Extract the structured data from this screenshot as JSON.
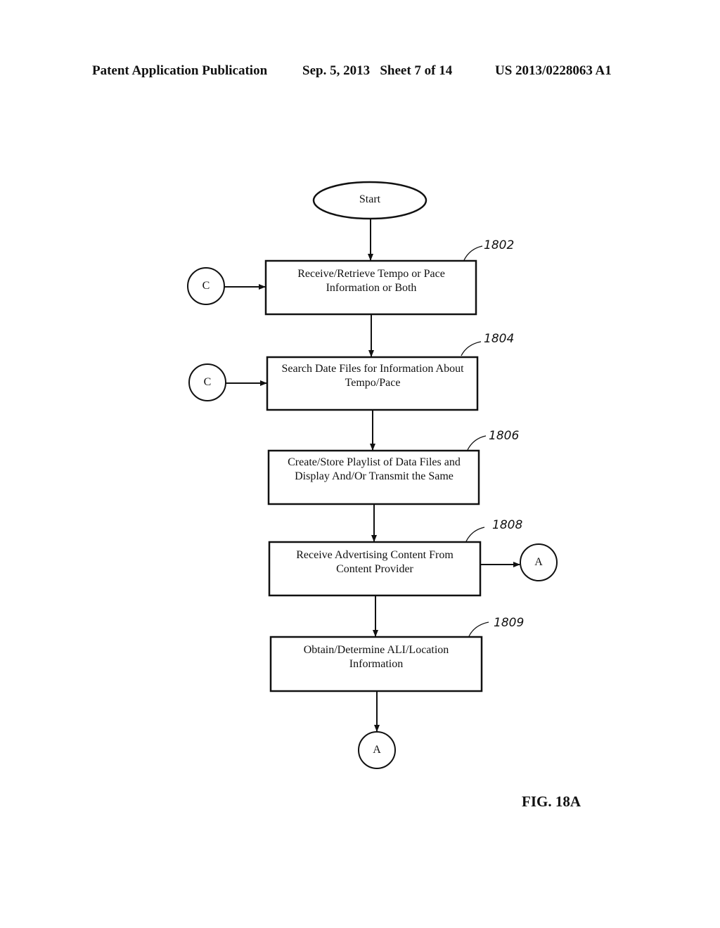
{
  "header": {
    "publication": "Patent Application Publication",
    "date_sheet": "Sep. 5, 2013   Sheet 7 of 14",
    "patent_number": "US 2013/0228063 A1"
  },
  "flowchart": {
    "start_label": "Start",
    "steps": [
      {
        "ref": "1802",
        "line1": "Receive/Retrieve Tempo or Pace",
        "line2": "Information or Both",
        "connector_in": "C"
      },
      {
        "ref": "1804",
        "line1": "Search Date Files for Information About",
        "line2": "Tempo/Pace",
        "connector_in": "C"
      },
      {
        "ref": "1806",
        "line1": "Create/Store Playlist of Data Files and",
        "line2": "Display And/Or Transmit the Same"
      },
      {
        "ref": "1808",
        "line1": "Receive Advertising Content From",
        "line2": "Content Provider",
        "connector_out": "A"
      },
      {
        "ref": "1809",
        "line1": "Obtain/Determine ALI/Location",
        "line2": "Information"
      }
    ],
    "end_connector": "A"
  },
  "figure_label": "FIG. 18A"
}
